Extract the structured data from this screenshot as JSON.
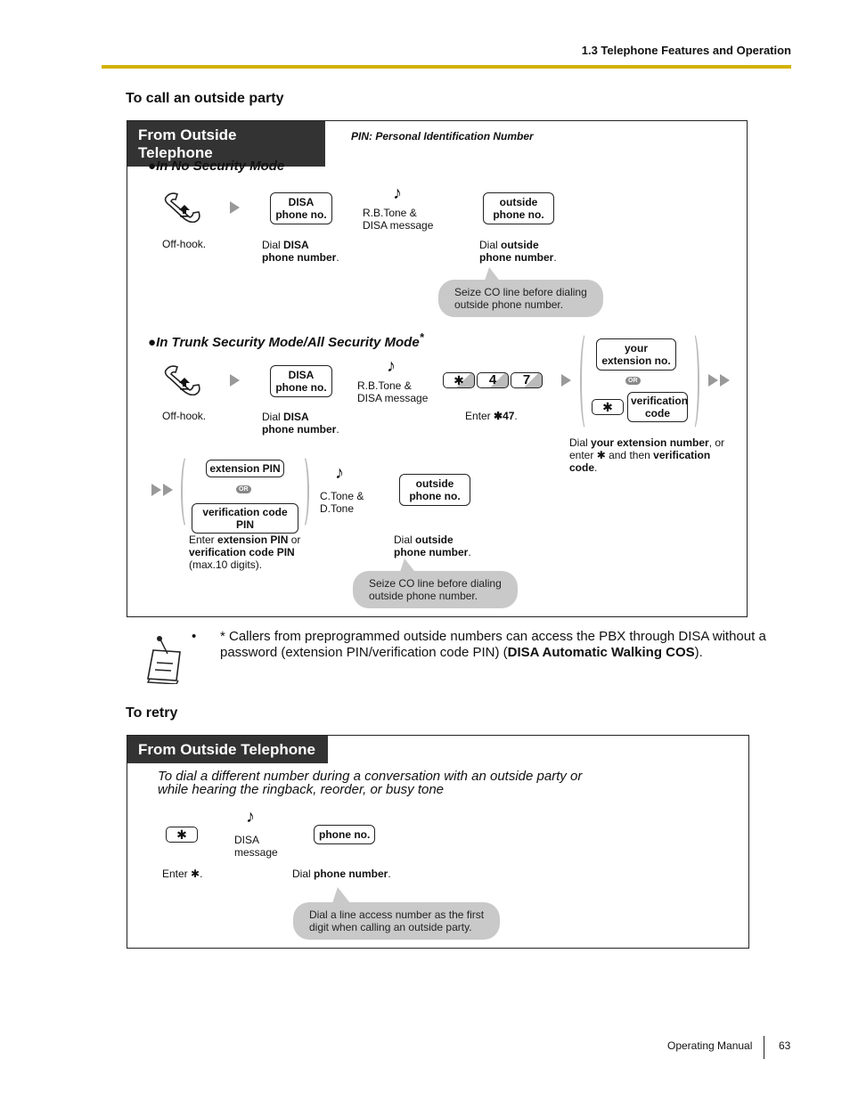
{
  "header": {
    "section": "1.3 Telephone Features and Operation"
  },
  "call_outside": {
    "title": "To call an outside party",
    "panel_tab": "From Outside Telephone",
    "pin_note": "PIN: Personal Identification Number",
    "no_security": {
      "mode_label": "In No Security Mode",
      "offhook_caption": "Off-hook.",
      "disa_key": [
        "DISA",
        "phone no."
      ],
      "disa_caption_pre": "Dial ",
      "disa_caption_bold1": "DISA",
      "disa_caption_bold2": "phone number",
      "tone_label": [
        "R.B.Tone &",
        "DISA message"
      ],
      "outside_key": [
        "outside",
        "phone no."
      ],
      "outside_caption_pre": "Dial ",
      "outside_caption_bold1": "outside",
      "outside_caption_bold2": "phone number",
      "bubble": [
        "Seize CO line before dialing",
        "outside phone number."
      ]
    },
    "trunk_security": {
      "mode_label": "In Trunk Security Mode/All Security Mode",
      "mode_asterisk": "*",
      "offhook_caption": "Off-hook.",
      "disa_key": [
        "DISA",
        "phone no."
      ],
      "disa_caption_pre": "Dial ",
      "disa_caption_bold1": "DISA",
      "disa_caption_bold2": "phone number",
      "tone_label": [
        "R.B.Tone &",
        "DISA message"
      ],
      "keys": [
        "✱",
        "4",
        "7"
      ],
      "keys_caption_pre": "Enter ",
      "keys_caption_bold": "✱47",
      "ext_key": [
        "your",
        "extension no."
      ],
      "or_label": "OR",
      "star_key": "✱",
      "verif_key": [
        "verification",
        "code"
      ],
      "ext_caption": {
        "pre": "Dial ",
        "bold1": "your extension number",
        "mid": ", or enter ",
        "star": "✱",
        "mid2": " and then ",
        "bold2": "verification code",
        "post": "."
      },
      "pin_key": "extension PIN",
      "verif_pin_key": "verification code PIN",
      "pin_caption": {
        "pre": "Enter ",
        "bold1": "extension PIN",
        "mid": " or ",
        "bold2": "verification code PIN",
        "post": "(max.10 digits)."
      },
      "ctone_label": [
        "C.Tone &",
        "D.Tone"
      ],
      "outside_key": [
        "outside",
        "phone no."
      ],
      "outside_caption_pre": "Dial ",
      "outside_caption_bold1": "outside",
      "outside_caption_bold2": "phone number",
      "bubble": [
        "Seize CO line before dialing",
        "outside phone number."
      ]
    }
  },
  "note": {
    "bullet": "•",
    "text_pre": "* Callers from preprogrammed outside numbers can access the PBX through DISA without a password (extension PIN/verification code PIN) (",
    "text_bold": "DISA Automatic Walking COS",
    "text_post": ")."
  },
  "retry": {
    "title": "To retry",
    "panel_tab": "From Outside Telephone",
    "description": [
      "To dial a different number during a conversation with an outside party or",
      "while hearing the ringback, reorder, or busy tone"
    ],
    "star_key": "✱",
    "star_caption_pre": "Enter ",
    "star_caption_star": "✱",
    "tone_label": [
      "DISA",
      "message"
    ],
    "phone_key": "phone no.",
    "phone_caption_pre": "Dial ",
    "phone_caption_bold": "phone number",
    "bubble": [
      "Dial a line access number as the first",
      "digit when calling an outside party."
    ]
  },
  "footer": {
    "manual": "Operating Manual",
    "page": "63"
  }
}
